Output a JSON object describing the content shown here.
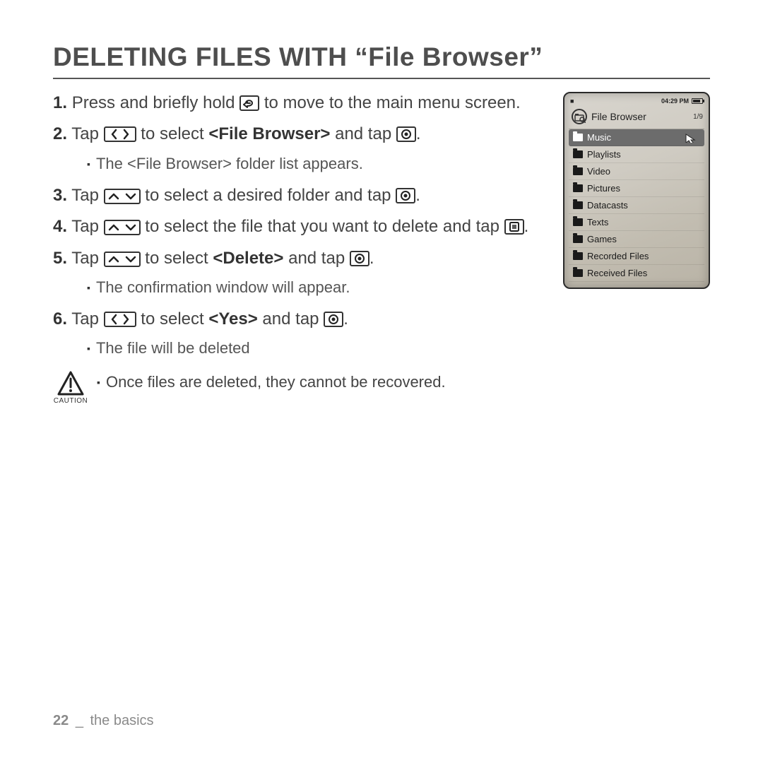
{
  "title": "DELETING FILES WITH “File Browser”",
  "steps": {
    "s1": {
      "num": "1.",
      "a": "Press and briefly hold ",
      "b": " to move to the main menu screen."
    },
    "s2": {
      "num": "2.",
      "a": "Tap ",
      "mid": " to select ",
      "bold": "<File Browser>",
      "c": " and tap ",
      "d": ".",
      "sub": "The <File Browser> folder list appears."
    },
    "s3": {
      "num": "3.",
      "a": "Tap ",
      "b": " to select a desired folder and tap ",
      "c": "."
    },
    "s4": {
      "num": "4.",
      "a": "Tap ",
      "b": " to select the file that you want to delete and tap ",
      "c": "."
    },
    "s5": {
      "num": "5.",
      "a": "Tap ",
      "mid": " to select ",
      "bold": "<Delete>",
      "c": " and tap ",
      "d": ".",
      "sub": "The confirmation window will appear."
    },
    "s6": {
      "num": "6.",
      "a": " Tap ",
      "mid": " to select ",
      "bold": "<Yes>",
      "c": " and tap ",
      "d": ".",
      "sub": "The file will be deleted"
    }
  },
  "caution": {
    "label": "CAUTION",
    "text": "Once files are deleted, they cannot be recovered."
  },
  "device": {
    "time": "04:29 PM",
    "title": "File Browser",
    "counter": "1/9",
    "items": [
      "Music",
      "Playlists",
      "Video",
      "Pictures",
      "Datacasts",
      "Texts",
      "Games",
      "Recorded Files",
      "Received Files"
    ],
    "selectedIndex": 0
  },
  "footer": {
    "page": "22",
    "sep": "_",
    "section": "the basics"
  }
}
